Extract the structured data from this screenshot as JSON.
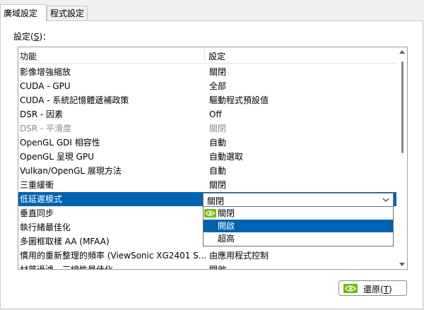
{
  "tabs": [
    {
      "label": "廣域設定",
      "active": true
    },
    {
      "label": "程式設定",
      "active": false
    }
  ],
  "settings_label": {
    "text": "設定(",
    "accel": "S",
    "suffix": ")："
  },
  "columns": {
    "feature": "功能",
    "setting": "設定"
  },
  "rows": [
    {
      "feature": "影像增強縮放",
      "value": "關閉",
      "state": "normal"
    },
    {
      "feature": "CUDA - GPU",
      "value": "全部",
      "state": "normal"
    },
    {
      "feature": "CUDA - 系統記憶體遞補政策",
      "value": "驅動程式預設值",
      "state": "normal"
    },
    {
      "feature": "DSR - 因素",
      "value": "Off",
      "state": "normal"
    },
    {
      "feature": "DSR - 平滑度",
      "value": "關閉",
      "state": "disabled"
    },
    {
      "feature": "OpenGL GDI 相容性",
      "value": "自動",
      "state": "normal"
    },
    {
      "feature": "OpenGL 呈現 GPU",
      "value": "自動選取",
      "state": "normal"
    },
    {
      "feature": "Vulkan/OpenGL 展現方法",
      "value": "自動",
      "state": "normal"
    },
    {
      "feature": "三重緩衝",
      "value": "關閉",
      "state": "normal"
    },
    {
      "feature": "低延遲模式",
      "value": "",
      "state": "selected"
    },
    {
      "feature": "垂直同步",
      "value": "",
      "state": "normal"
    },
    {
      "feature": "執行緒最佳化",
      "value": "",
      "state": "normal"
    },
    {
      "feature": "多圖框取樣 AA (MFAA)",
      "value": "",
      "state": "normal"
    },
    {
      "feature": "慣用的重新整理的頻率 (ViewSonic XG2401 S...",
      "value": "由應用程式控制",
      "state": "normal"
    },
    {
      "feature": "材質過濾 - 三線性最佳化",
      "value": "開啟",
      "state": "normal"
    }
  ],
  "combo": {
    "value": "關閉"
  },
  "dropdown_options": [
    {
      "label": "關閉",
      "nvidia_icon": true,
      "highlighted": false
    },
    {
      "label": "開啟",
      "nvidia_icon": false,
      "highlighted": true
    },
    {
      "label": "超高",
      "nvidia_icon": false,
      "highlighted": false
    }
  ],
  "restore_button": {
    "text": "還原(",
    "accel": "T",
    "suffix": ")"
  },
  "colors": {
    "selection": "#0063b1",
    "nvidia_green": "#76b900"
  }
}
